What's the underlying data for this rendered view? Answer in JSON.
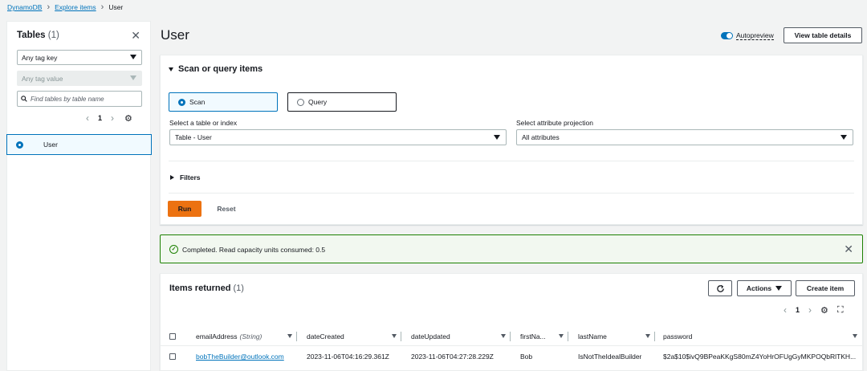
{
  "breadcrumb": {
    "items": [
      "DynamoDB",
      "Explore items",
      "User"
    ]
  },
  "sidebar": {
    "title": "Tables",
    "count": "(1)",
    "tag_key": "Any tag key",
    "tag_value": "Any tag value",
    "search_placeholder": "Find tables by table name",
    "page": "1",
    "tables": [
      {
        "label": "User",
        "selected": true
      }
    ]
  },
  "header": {
    "title": "User",
    "autopreview_label": "Autopreview",
    "autopreview_on": true,
    "view_details_label": "View table details"
  },
  "scan_panel": {
    "heading": "Scan or query items",
    "modes": [
      {
        "label": "Scan",
        "selected": true
      },
      {
        "label": "Query",
        "selected": false
      }
    ],
    "table_label": "Select a table or index",
    "table_value": "Table - User",
    "projection_label": "Select attribute projection",
    "projection_value": "All attributes",
    "filters_label": "Filters",
    "run_label": "Run",
    "reset_label": "Reset"
  },
  "status": {
    "message": "Completed. Read capacity units consumed: 0.5",
    "color": "#1d8102"
  },
  "items": {
    "heading": "Items returned",
    "count": "(1)",
    "actions_label": "Actions",
    "create_label": "Create item",
    "page": "1",
    "columns": [
      {
        "name": "emailAddress",
        "type": "(String)"
      },
      {
        "name": "dateCreated",
        "type": ""
      },
      {
        "name": "dateUpdated",
        "type": ""
      },
      {
        "name": "firstNa...",
        "type": ""
      },
      {
        "name": "lastName",
        "type": ""
      },
      {
        "name": "password",
        "type": ""
      }
    ],
    "rows": [
      {
        "emailAddress": "bobTheBuilder@outlook.com",
        "dateCreated": "2023-11-06T04:16:29.361Z",
        "dateUpdated": "2023-11-06T04:27:28.229Z",
        "firstName": "Bob",
        "lastName": "IsNotTheIdealBuilder",
        "password": "$2a$10$ivQ9BPeaKKgS80mZ4YoHrOFUgGyMKPOQbRlTKH..."
      }
    ]
  },
  "colors": {
    "accent": "#0073bb",
    "primary_button": "#ec7211",
    "success": "#1d8102"
  }
}
